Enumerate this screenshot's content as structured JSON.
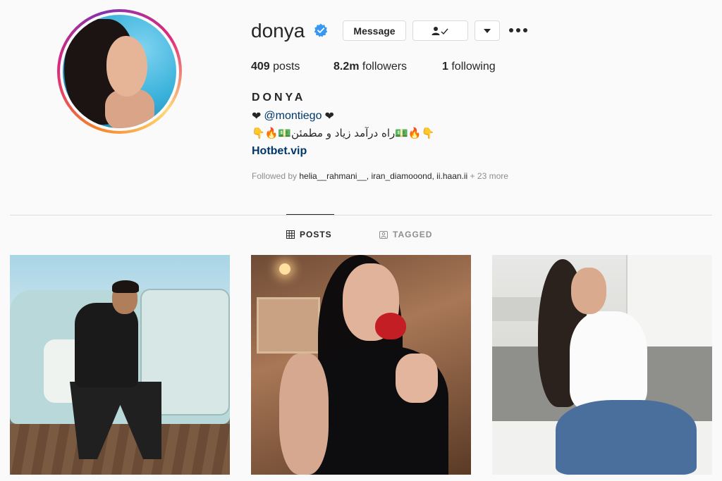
{
  "profile": {
    "username": "donya",
    "verified": true,
    "full_name": "DONYA",
    "bio_line1": {
      "heart_left": "❤",
      "mention": "@montiego",
      "heart_right": "❤"
    },
    "bio_line2": "👇🔥💵راه درآمد زیاد و مطمئن💵🔥👇",
    "website": "Hotbet.vip"
  },
  "actions": {
    "message_label": "Message",
    "following_icon": "person-check-icon",
    "dropdown_icon": "caret-down-icon",
    "more_icon": "more-horizontal-icon"
  },
  "stats": {
    "posts_count": "409",
    "posts_label": "posts",
    "followers_count": "8.2m",
    "followers_label": "followers",
    "following_count": "1",
    "following_label": "following"
  },
  "followed_by": {
    "prefix": "Followed by",
    "names": "helia__rahmani__, iran_diamooond, ii.haan.ii",
    "more": "+ 23 more"
  },
  "tabs": [
    {
      "label": "POSTS",
      "icon": "grid-icon",
      "active": true
    },
    {
      "label": "TAGGED",
      "icon": "tag-person-icon",
      "active": false
    }
  ],
  "colors": {
    "text": "#262626",
    "secondary": "#8e8e8e",
    "link": "#00376b",
    "verified_blue": "#3897f0",
    "border": "#dbdbdb",
    "background": "#fafafa"
  }
}
